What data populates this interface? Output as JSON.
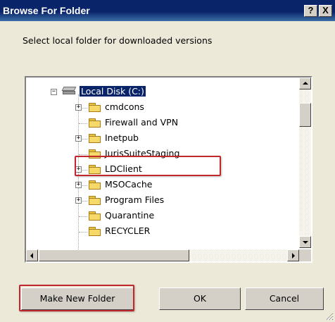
{
  "window": {
    "title": "Browse For Folder",
    "help_label": "?",
    "close_label": "X"
  },
  "prompt": "Select local folder for downloaded versions",
  "tree": {
    "root": {
      "label": "Local Disk (C:)",
      "expander": "−",
      "selected": true
    },
    "items": [
      {
        "label": "cmdcons",
        "expander": "+",
        "highlighted": false
      },
      {
        "label": "Firewall and VPN",
        "expander": "",
        "highlighted": false
      },
      {
        "label": "Inetpub",
        "expander": "+",
        "highlighted": false
      },
      {
        "label": "JurisSuiteStaging",
        "expander": "",
        "highlighted": true
      },
      {
        "label": "LDClient",
        "expander": "+",
        "highlighted": false
      },
      {
        "label": "MSOCache",
        "expander": "+",
        "highlighted": false
      },
      {
        "label": "Program Files",
        "expander": "+",
        "highlighted": false
      },
      {
        "label": "Quarantine",
        "expander": "",
        "highlighted": false
      },
      {
        "label": "RECYCLER",
        "expander": "",
        "highlighted": false
      }
    ]
  },
  "buttons": {
    "new_folder": "Make New Folder",
    "ok": "OK",
    "cancel": "Cancel"
  },
  "colors": {
    "selection": "#0a246a",
    "callout": "#c0282d",
    "folder": "#f7d96a"
  }
}
